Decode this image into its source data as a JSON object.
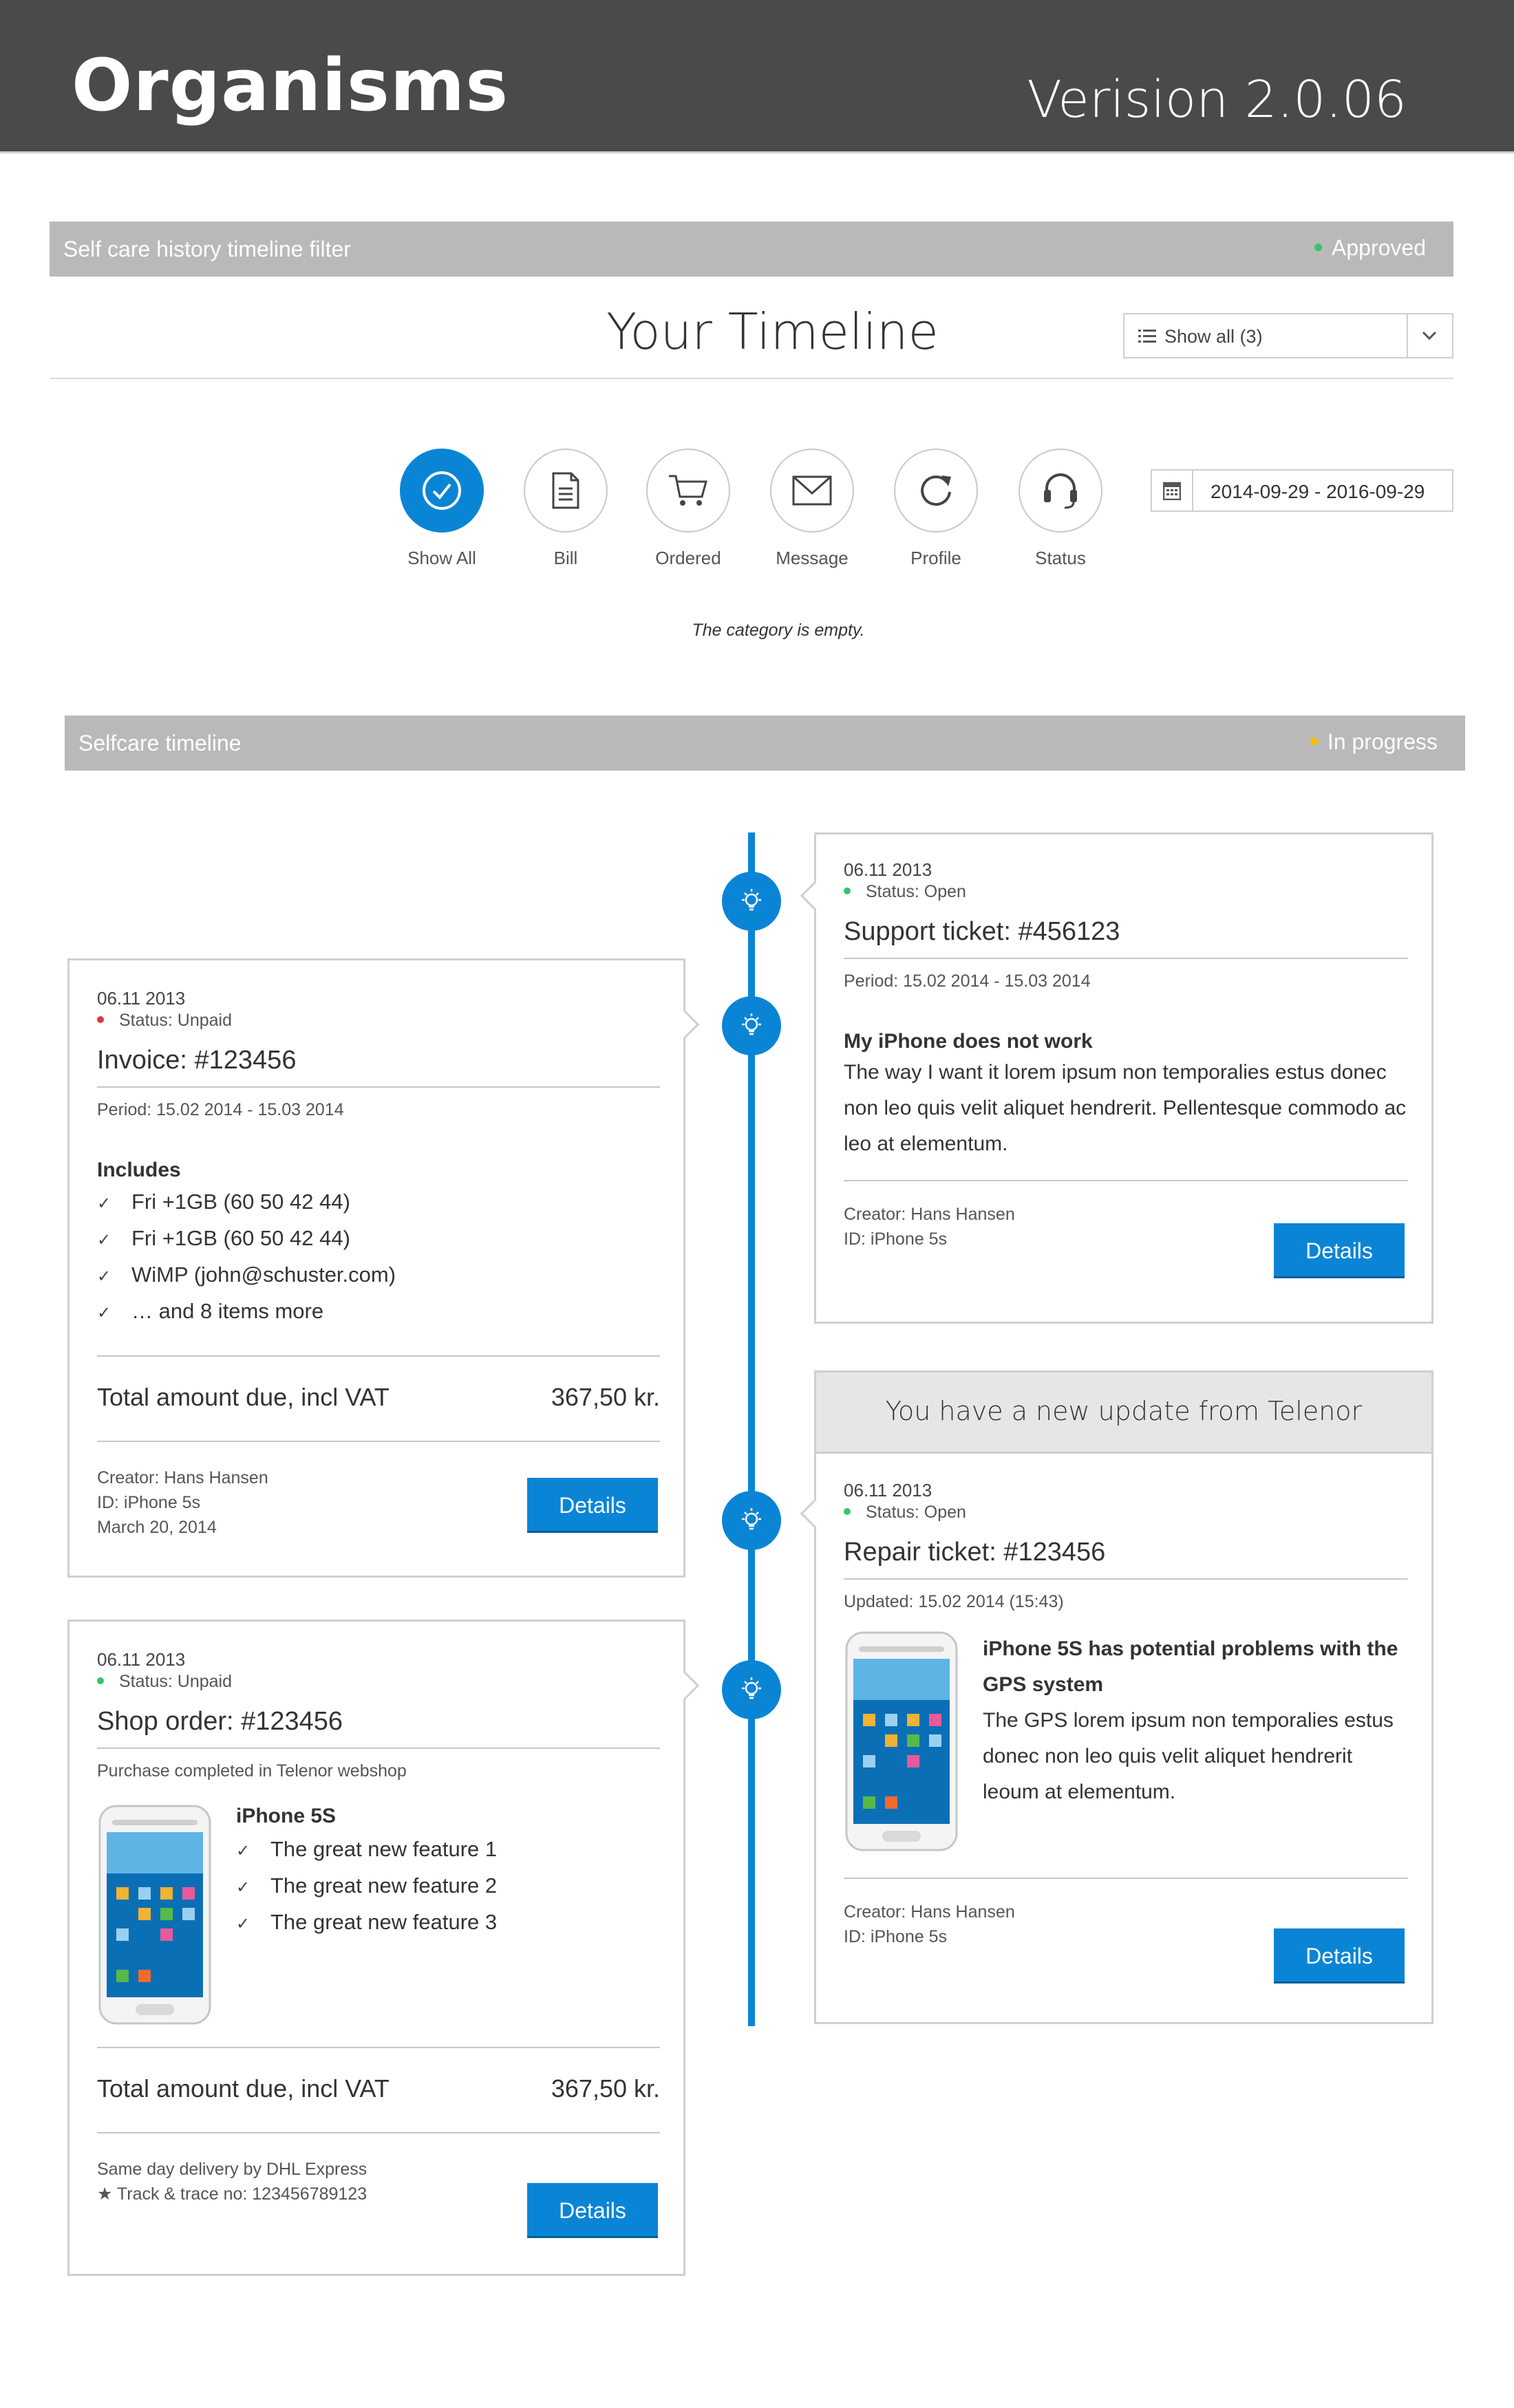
{
  "header": {
    "title": "Organisms",
    "version": "Verision 2.0.06"
  },
  "filter_section": {
    "label": "Self care history timeline filter",
    "status": "Approved",
    "status_color": "#36c36b"
  },
  "timeline_header": {
    "title": "Your Timeline",
    "select_value": "Show all (3)"
  },
  "filters": [
    {
      "label": "Show All",
      "icon": "check-icon",
      "active": true
    },
    {
      "label": "Bill",
      "icon": "document-icon"
    },
    {
      "label": "Ordered",
      "icon": "cart-icon"
    },
    {
      "label": "Message",
      "icon": "envelope-icon"
    },
    {
      "label": "Profile",
      "icon": "refresh-icon"
    },
    {
      "label": "Status",
      "icon": "headset-icon"
    }
  ],
  "date_range": "2014-09-29 - 2016-09-29",
  "empty_message": "The category is empty.",
  "timeline_section": {
    "label": "Selfcare timeline",
    "status": "In progress",
    "status_color": "#f2c200"
  },
  "accent_color": "#0a85d6",
  "support_card": {
    "date": "06.11 2013",
    "status": "Status: Open",
    "title": "Support ticket: #456123",
    "period": "Period: 15.02 2014 - 15.03 2014",
    "heading": "My iPhone does not work",
    "body": "The way I want it lorem ipsum non temporalies estus donec non leo quis velit aliquet hendrerit. Pellentesque commodo ac leo at elementum.",
    "creator": "Creator: Hans Hansen",
    "id": "ID: iPhone 5s",
    "button": "Details"
  },
  "invoice_card": {
    "date": "06.11 2013",
    "status": "Status: Unpaid",
    "title": "Invoice: #123456",
    "period": "Period: 15.02 2014 - 15.03 2014",
    "includes_label": "Includes",
    "items": [
      "Fri +1GB (60 50 42 44)",
      "Fri +1GB (60 50 42 44)",
      "WiMP (john@schuster.com)",
      "… and 8 items more"
    ],
    "total_label": "Total amount due, incl VAT",
    "total_value": "367,50 kr.",
    "creator": "Creator: Hans Hansen",
    "id": "ID: iPhone 5s",
    "date_line": "March 20, 2014",
    "button": "Details"
  },
  "repair_card": {
    "update_header": "You have a new update from Telenor",
    "date": "06.11 2013",
    "status": "Status: Open",
    "title": "Repair ticket: #123456",
    "updated": "Updated: 15.02 2014 (15:43)",
    "heading": "iPhone 5S has potential problems with the GPS system",
    "body": "The GPS lorem ipsum non temporalies estus donec non leo quis velit aliquet hendrerit leoum at elementum.",
    "creator": "Creator: Hans Hansen",
    "id": "ID: iPhone 5s",
    "button": "Details"
  },
  "shop_card": {
    "date": "06.11 2013",
    "status": "Status: Unpaid",
    "title": "Shop order: #123456",
    "subtitle": "Purchase completed in Telenor webshop",
    "product": "iPhone 5S",
    "features": [
      "The great new feature 1",
      "The great new feature 2",
      "The great new feature 3"
    ],
    "total_label": "Total amount due, incl VAT",
    "total_value": "367,50 kr.",
    "delivery": "Same day delivery by DHL Express",
    "tracking": "★ Track & trace no: 123456789123",
    "button": "Details"
  }
}
